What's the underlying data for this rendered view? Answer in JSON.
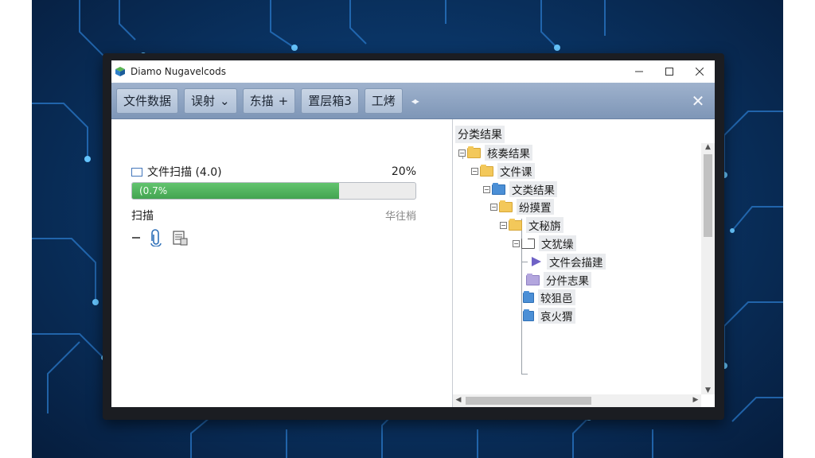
{
  "window": {
    "title": "Diamo Nugavelcods",
    "controls": [
      "minimize",
      "maximize",
      "close"
    ]
  },
  "toolbar": {
    "buttons": [
      {
        "label": "文件数据"
      },
      {
        "label": "误射",
        "suffix": "⌄"
      },
      {
        "label": "东描",
        "suffix": "+"
      },
      {
        "label": "置层箱3"
      },
      {
        "label": "工烤"
      }
    ],
    "extra_icon": "double-arrow-icon",
    "close_icon": "close-icon"
  },
  "scan": {
    "title": "文件扫描 (4.0)",
    "percent_label": "20%",
    "progress_text": "(0.7%",
    "progress_value": 0.73,
    "status_left": "扫描",
    "status_right": "华往梢",
    "icons": [
      "minus-icon",
      "paperclip-icon",
      "document-icon"
    ]
  },
  "tree": {
    "header": "分类结果",
    "items": [
      {
        "label": "核奏结果",
        "color": "yellow"
      },
      {
        "label": "文件课",
        "color": "yellow"
      },
      {
        "label": "文类结果",
        "color": "blue"
      },
      {
        "label": "纷摸置",
        "color": "yellow"
      },
      {
        "label": "文秘旃",
        "color": "yellow"
      },
      {
        "label": "文犹缲",
        "color": "white"
      },
      {
        "label": "文件会描建",
        "color": "purple"
      },
      {
        "label": "分件志果",
        "color": "purple"
      },
      {
        "label": "较狙邑",
        "color": "blue"
      },
      {
        "label": "哀火猬",
        "color": "blue"
      }
    ]
  },
  "colors": {
    "toolbar": "#8aa0bf",
    "progress_fill": "#4cae5a",
    "background": "#0a3566"
  }
}
